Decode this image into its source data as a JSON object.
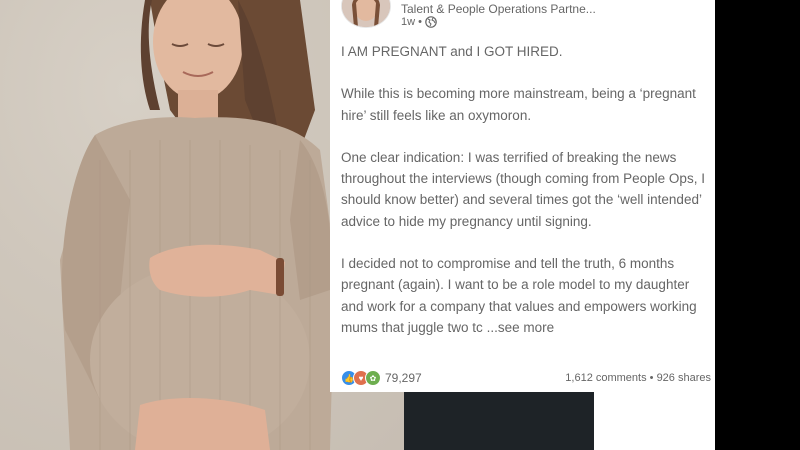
{
  "author": {
    "subtitle": "Talent & People Operations Partne...",
    "time": "1w •"
  },
  "post": {
    "paragraphs": [
      "I AM PREGNANT and I GOT HIRED.",
      "While this is becoming more mainstream, being a ‘pregnant hire’ still feels like an oxymoron.",
      "One clear indication: I was terrified of breaking the news throughout the interviews (though coming from People Ops, I should know better) and several times got the  ‘well intended’ advice to hide my pregnancy until signing.",
      "I decided not to compromise and tell the truth, 6 months pregnant (again). I want to be a role model to my daughter and work for a company that values and empowers working mums that juggle two tc"
    ],
    "see_more": "...see more"
  },
  "engagement": {
    "reaction_count": "79,297",
    "comments_shares": "1,612 comments • 926 shares",
    "reaction_icons": [
      "like-icon",
      "love-icon",
      "support-icon"
    ]
  },
  "colors": {
    "like": "#378fe9",
    "love": "#df704d",
    "support": "#6dae4f",
    "text": "#666666"
  }
}
